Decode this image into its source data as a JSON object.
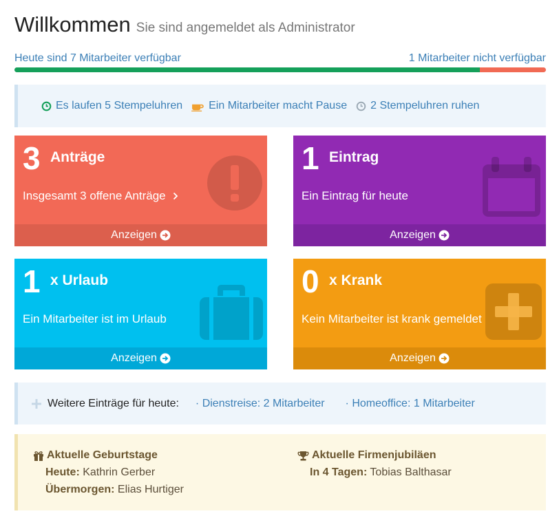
{
  "header": {
    "title": "Willkommen",
    "subtitle": "Sie sind angemeldet als Administrator"
  },
  "availability": {
    "available_label": "Heute sind 7 Mitarbeiter verfügbar",
    "unavailable_label": "1 Mitarbeiter nicht verfügbar",
    "available_fraction": 0.875,
    "unavailable_fraction": 0.125,
    "available_color": "#15a05a",
    "unavailable_color": "#f16a54"
  },
  "clocks": {
    "running": {
      "icon": "clock-running-icon",
      "label": "Es laufen 5 Stempeluhren",
      "icon_color": "#15a05a"
    },
    "pause": {
      "icon": "coffee-icon",
      "label": "Ein Mitarbeiter macht Pause",
      "icon_color": "#f0a030"
    },
    "idle": {
      "icon": "clock-idle-icon",
      "label": "2 Stempeluhren ruhen",
      "icon_color": "#9aa8b3"
    }
  },
  "tiles": {
    "requests": {
      "count": "3",
      "title": "Anträge",
      "description": "Insgesamt 3 offene Anträge",
      "action": "Anzeigen",
      "icon": "exclamation-circle-icon",
      "color": "#f26956"
    },
    "entries": {
      "count": "1",
      "title": "Eintrag",
      "description": "Ein Eintrag für heute",
      "action": "Anzeigen",
      "icon": "calendar-icon",
      "color": "#912ab3"
    },
    "vacation": {
      "count": "1",
      "title": "x Urlaub",
      "description": "Ein Mitarbeiter ist im Urlaub",
      "action": "Anzeigen",
      "icon": "suitcase-icon",
      "color": "#00c0ef"
    },
    "sick": {
      "count": "0",
      "title": "x Krank",
      "description": "Kein Mitarbeiter ist krank gemeldet",
      "action": "Anzeigen",
      "icon": "medical-plus-icon",
      "color": "#f39c12"
    }
  },
  "more_entries": {
    "label": "Weitere Einträge für heute:",
    "items": [
      "· Dienstreise: 2 Mitarbeiter",
      "· Homeoffice: 1 Mitarbeiter"
    ]
  },
  "birthdays": {
    "title": "Aktuelle Geburtstage",
    "rows": [
      {
        "when": "Heute:",
        "name": "Kathrin Gerber"
      },
      {
        "when": "Übermorgen:",
        "name": "Elias Hurtiger"
      }
    ]
  },
  "anniversaries": {
    "title": "Aktuelle Firmenjubiläen",
    "rows": [
      {
        "when": "In 4 Tagen:",
        "name": "Tobias Balthasar"
      }
    ]
  }
}
